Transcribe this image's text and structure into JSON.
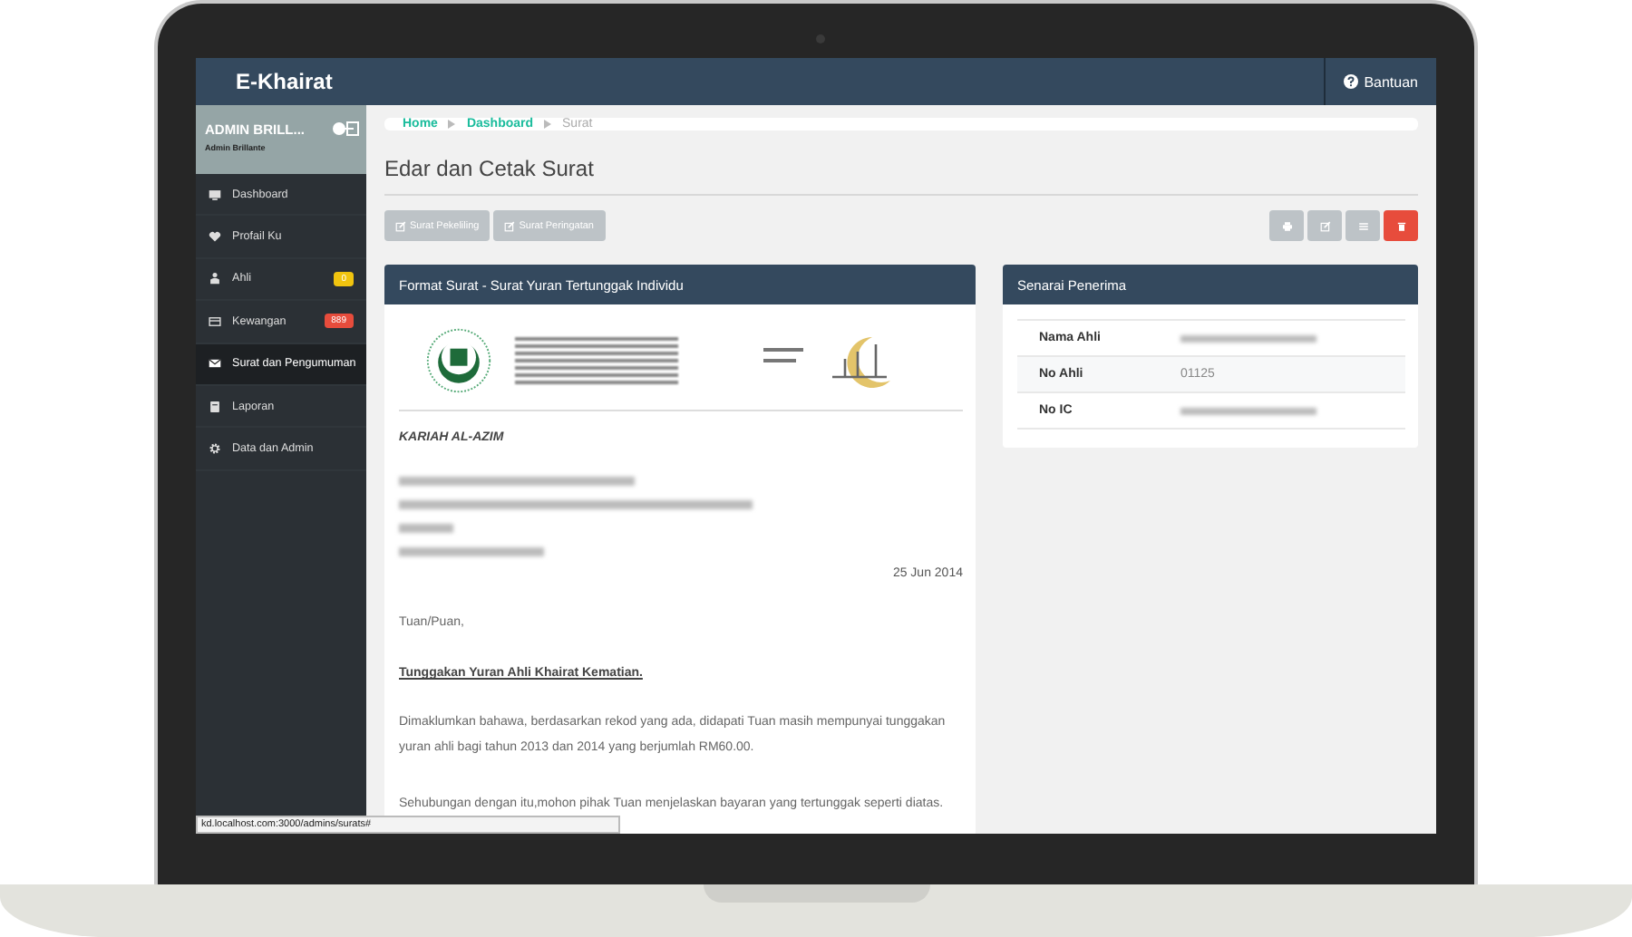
{
  "app": {
    "title": "E-Khairat",
    "help": "Bantuan"
  },
  "user": {
    "name": "ADMIN BRILL...",
    "role": "Admin Brillante"
  },
  "nav": [
    {
      "label": "Dashboard",
      "kind": "monitor",
      "selected": false
    },
    {
      "label": "Profail Ku",
      "kind": "heart",
      "selected": false
    },
    {
      "label": "Ahli",
      "kind": "person",
      "selected": false,
      "badge": "0",
      "color": "#f1c40f"
    },
    {
      "label": "Kewangan",
      "kind": "card",
      "selected": false,
      "badge": "889",
      "color": "#e74c3c"
    },
    {
      "label": "Surat dan Pengumuman",
      "kind": "envelope",
      "selected": true
    },
    {
      "label": "Laporan",
      "kind": "report",
      "selected": false
    },
    {
      "label": "Data dan Admin",
      "kind": "gear",
      "selected": false
    }
  ],
  "breadcrumb": [
    {
      "label": "Home",
      "kind": "link"
    },
    {
      "label": "Dashboard",
      "kind": "link"
    },
    {
      "label": "Surat",
      "kind": "current"
    }
  ],
  "page_title": "Edar dan Cetak Surat",
  "actions": [
    {
      "label": "Surat Pekeliling"
    },
    {
      "label": "Surat Peringatan"
    }
  ],
  "tools": [
    {
      "kind": "print"
    },
    {
      "kind": "edit"
    },
    {
      "kind": "list"
    },
    {
      "kind": "trash"
    }
  ],
  "letter": {
    "title": "Format Surat - Surat Yuran Tertunggak Individu",
    "heading": "KARIAH AL-AZIM",
    "date": "25 Jun 2014",
    "salutation": "Tuan/Puan,",
    "subject": "Tunggakan Yuran Ahli Khairat Kematian.",
    "paragraphs": [
      "Dimaklumkan bahawa, berdasarkan rekod yang ada, didapati Tuan masih mempunyai tunggakan yuran ahli bagi tahun 2013 dan 2014 yang berjumlah RM60.00.",
      "Sehubungan dengan itu,mohon pihak Tuan menjelaskan bayaran yang tertunggak seperti diatas."
    ]
  },
  "recipients": {
    "title": "Senarai Penerima",
    "rows": [
      {
        "label": "Nama Ahli"
      },
      {
        "label": "No Ahli",
        "value": "01125"
      },
      {
        "label": "No IC"
      }
    ]
  },
  "status_bar": {
    "url": "kd.localhost.com:3000/admins/surats#"
  }
}
